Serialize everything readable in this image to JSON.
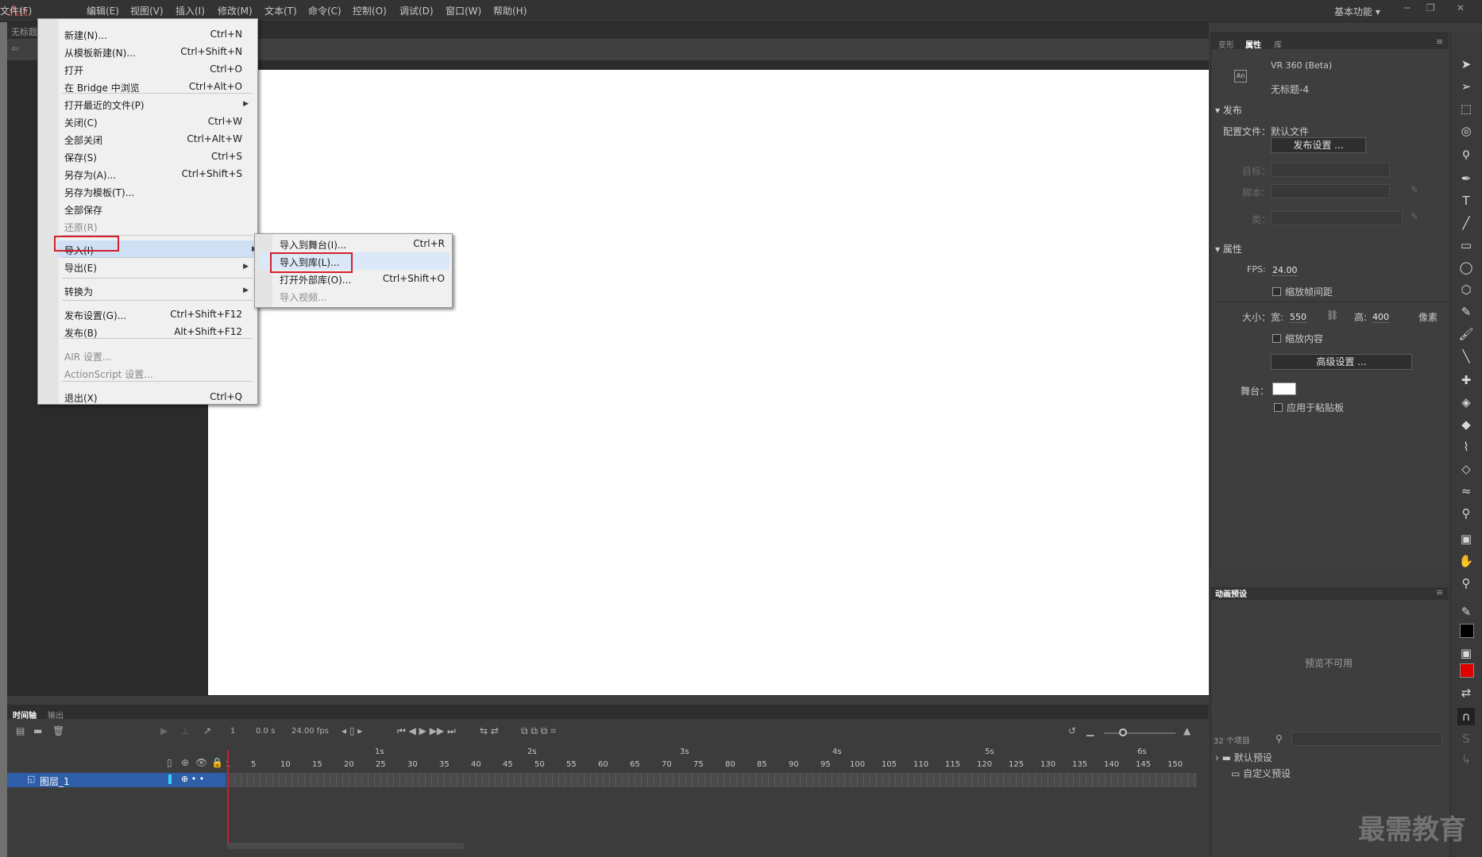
{
  "app": {
    "logo": "An"
  },
  "menubar": {
    "items": [
      "文件(F)",
      "编辑(E)",
      "视图(V)",
      "插入(I)",
      "修改(M)",
      "文本(T)",
      "命令(C)",
      "控制(O)",
      "调试(D)",
      "窗口(W)",
      "帮助(H)"
    ],
    "workspace": "基本功能",
    "window_controls": [
      "─",
      "❐",
      "✕"
    ]
  },
  "document": {
    "tab": "无标题",
    "back_icon": "left-arrow-icon"
  },
  "file_menu": {
    "items": [
      {
        "label": "新建(N)...",
        "shortcut": "Ctrl+N"
      },
      {
        "label": "从模板新建(N)...",
        "shortcut": "Ctrl+Shift+N"
      },
      {
        "label": "打开",
        "shortcut": "Ctrl+O"
      },
      {
        "label": "在 Bridge 中浏览",
        "shortcut": "Ctrl+Alt+O"
      },
      {
        "label": "打开最近的文件(P)",
        "shortcut": ""
      },
      {
        "label": "关闭(C)",
        "shortcut": "Ctrl+W"
      },
      {
        "label": "全部关闭",
        "shortcut": "Ctrl+Alt+W"
      },
      {
        "label": "保存(S)",
        "shortcut": "Ctrl+S"
      },
      {
        "label": "另存为(A)...",
        "shortcut": "Ctrl+Shift+S"
      },
      {
        "label": "另存为模板(T)...",
        "shortcut": ""
      },
      {
        "label": "全部保存",
        "shortcut": ""
      },
      {
        "label": "还原(R)",
        "shortcut": ""
      },
      {
        "label": "导入(I)",
        "shortcut": ""
      },
      {
        "label": "导出(E)",
        "shortcut": ""
      },
      {
        "label": "转换为",
        "shortcut": ""
      },
      {
        "label": "发布设置(G)...",
        "shortcut": "Ctrl+Shift+F12"
      },
      {
        "label": "发布(B)",
        "shortcut": "Alt+Shift+F12"
      },
      {
        "label": "AIR 设置...",
        "shortcut": ""
      },
      {
        "label": "ActionScript 设置...",
        "shortcut": ""
      },
      {
        "label": "退出(X)",
        "shortcut": "Ctrl+Q"
      }
    ]
  },
  "import_submenu": {
    "items": [
      {
        "label": "导入到舞台(I)...",
        "shortcut": "Ctrl+R"
      },
      {
        "label": "导入到库(L)...",
        "shortcut": ""
      },
      {
        "label": "打开外部库(O)...",
        "shortcut": "Ctrl+Shift+O"
      },
      {
        "label": "导入视频...",
        "shortcut": ""
      }
    ]
  },
  "properties_panel": {
    "tabs": [
      "变形",
      "属性",
      "库"
    ],
    "doc_type": "VR 360 (Beta)",
    "doc_name": "无标题-4",
    "publish_section": "发布",
    "profile_label": "配置文件：默认文件",
    "publish_settings_button": "发布设置 ...",
    "target_label": "目标：",
    "script_label": "脚本：",
    "class_label": "类：",
    "properties_section": "属性",
    "fps_label": "FPS:",
    "fps_value": "24.00",
    "scale_spans_label": "缩放帧间距",
    "size_label": "大小：",
    "width_label": "宽:",
    "width_value": "550",
    "height_label": "高:",
    "height_value": "400",
    "units": "像素",
    "scale_content_label": "缩放内容",
    "advanced_button": "高级设置 ...",
    "stage_label": "舞台：",
    "apply_pasteboard_label": "应用于粘贴板",
    "stage_color": "#ffffff"
  },
  "presets_panel": {
    "tab": "动画预设",
    "preview_text": "预览不可用",
    "count": "32 个项目",
    "folders": [
      "默认预设",
      "自定义预设"
    ]
  },
  "timeline": {
    "tabs": [
      "时间轴",
      "输出"
    ],
    "frame": "1",
    "time": "0.0 s",
    "fps": "24.00 fps",
    "layer_name": "图层_1",
    "seconds": [
      "1s",
      "2s",
      "3s",
      "4s",
      "5s",
      "6s"
    ],
    "frame_ticks": [
      "1",
      "5",
      "10",
      "15",
      "20",
      "25",
      "30",
      "35",
      "40",
      "45",
      "50",
      "55",
      "60",
      "65",
      "70",
      "75",
      "80",
      "85",
      "90",
      "95",
      "100",
      "105",
      "110",
      "115",
      "120",
      "125",
      "130",
      "135",
      "140",
      "145",
      "150"
    ]
  },
  "watermark": "最需教育",
  "colors": {
    "highlight_box": "#d2202e",
    "layer_selected": "#2f5ea8"
  }
}
